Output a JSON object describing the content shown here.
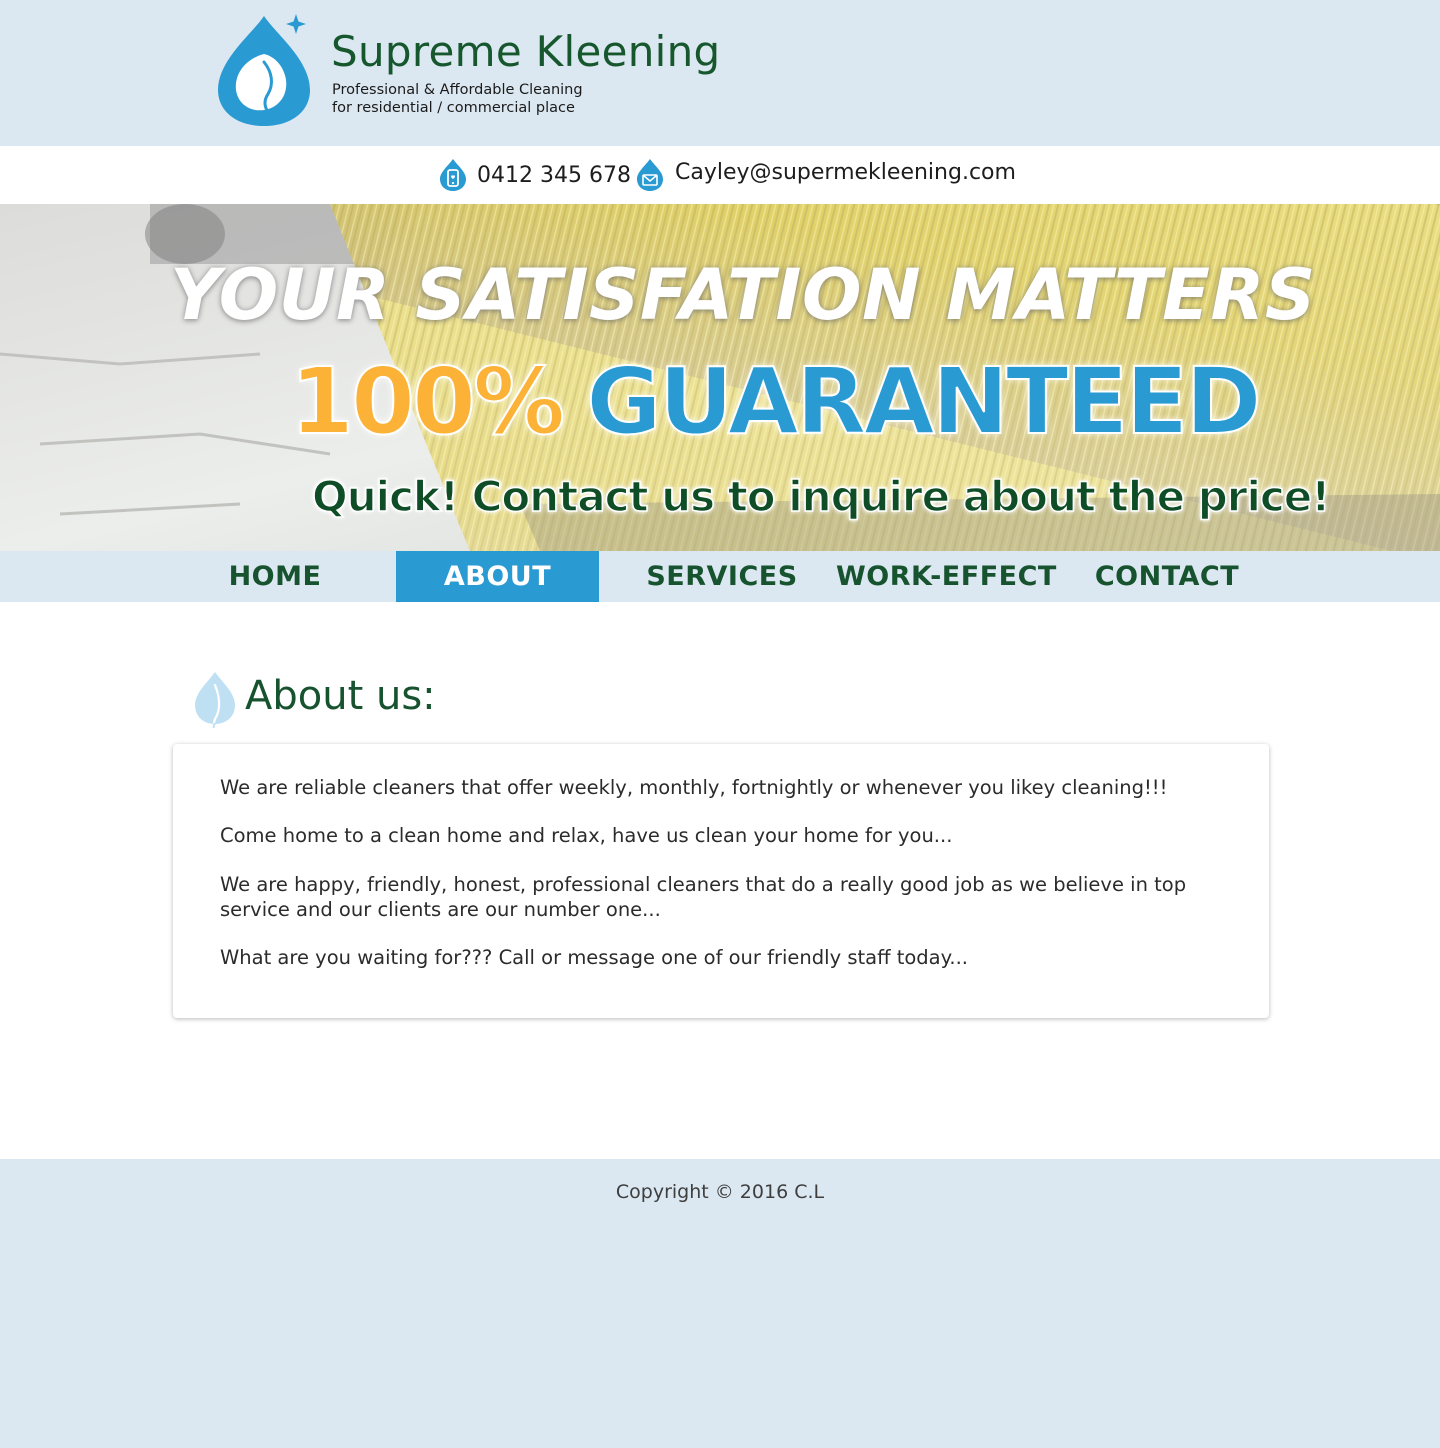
{
  "header": {
    "brand_name": "Supreme Kleening",
    "tagline_line1": "Professional & Affordable Cleaning",
    "tagline_line2": "for residential / commercial place",
    "logo_icon": "water-drop-leaf-logo-icon"
  },
  "contact": {
    "phone": "0412 345 678",
    "email": "Cayley@supermekleening.com",
    "phone_icon": "phone-drop-icon",
    "email_icon": "mail-drop-icon"
  },
  "hero": {
    "line1": "YOUR SATISFATION MATTERS",
    "line2_part1": "100%",
    "line2_part2": "GUARANTEED",
    "line3": "Quick! Contact us to inquire about the price!"
  },
  "nav": {
    "items": [
      {
        "label": "HOME",
        "active": false
      },
      {
        "label": "ABOUT",
        "active": true
      },
      {
        "label": "SERVICES",
        "active": false
      },
      {
        "label": "WORK-EFFECT",
        "active": false
      },
      {
        "label": "CONTACT",
        "active": false
      }
    ]
  },
  "about": {
    "title": "About us:",
    "paragraphs": [
      "We are reliable cleaners that offer weekly, monthly, fortnightly or whenever you likey cleaning!!!",
      "Come home to a clean home and relax, have us clean your home for you...",
      "We are happy, friendly, honest, professional cleaners that do a really good job as we believe in top service and our clients are our number one...",
      "What are you waiting for??? Call or message one of our friendly staff today..."
    ]
  },
  "footer": {
    "copyright": "Copyright © 2016 C.L"
  },
  "colors": {
    "brand_green": "#16532e",
    "accent_blue": "#2a9ad3",
    "page_bg": "#dce8f1",
    "guarantee_orange": "#fbb236"
  }
}
